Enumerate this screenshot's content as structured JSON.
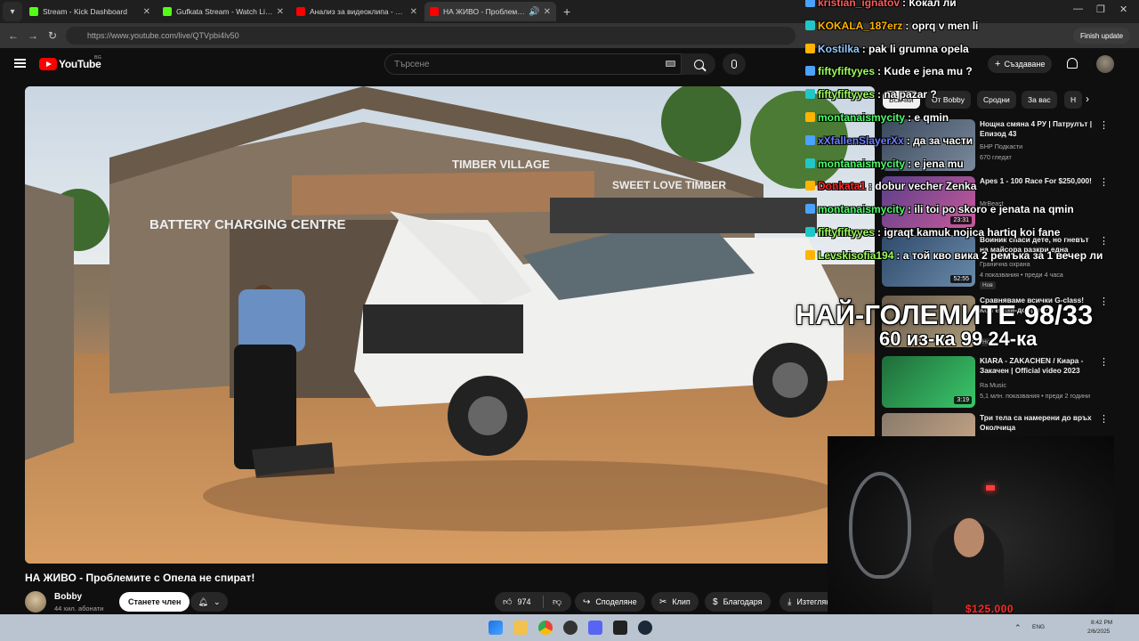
{
  "browser": {
    "tabs": [
      {
        "title": "Stream - Kick Dashboard",
        "color": "#53fc18",
        "active": false
      },
      {
        "title": "Gufkata Stream - Watch Live on Kick",
        "color": "#53fc18",
        "active": false
      },
      {
        "title": "Анализ за видеоклипа - YouTube Studio",
        "color": "#ff0000",
        "active": false
      },
      {
        "title": "НА ЖИВО - Проблемите с Опела не спират!",
        "color": "#ff0000",
        "active": true
      }
    ],
    "url": "https://www.youtube.com/live/QTVpbi4lv50",
    "finish_update": "Finish update"
  },
  "youtube": {
    "logo_text": "YouTube",
    "region": "BG",
    "search_placeholder": "Търсене",
    "create_label": "Създаване"
  },
  "video": {
    "title": "НА ЖИВО - Проблемите с Опела не спират!",
    "channel": "Bobby",
    "subscribers": "44 хил. абонати",
    "join_label": "Станете член",
    "likes": "974",
    "share_label": "Споделяне",
    "clip_label": "Клип",
    "thanks_label": "Благодаря",
    "download_label": "Изтегляне",
    "scene_signs": [
      "BATTERY CHARGING CENTRE",
      "TIMBER VILLAGE",
      "SWEET LOVE TIMBER"
    ]
  },
  "sidebar": {
    "chips": [
      "Всички",
      "От Bobby",
      "Сродни",
      "За вас",
      "Н"
    ],
    "recs": [
      {
        "title": "Нощна смяна 4 РУ | Патрулът | Епизод 43",
        "channel": "БНР Подкасти",
        "meta": "670 гледат",
        "badge": "",
        "duration": "",
        "thumb": "#3a4a5c"
      },
      {
        "title": "Apes 1 - 100 Race For $250,000!",
        "channel": "MrBeast",
        "meta": "",
        "badge": "",
        "duration": "23:31",
        "thumb": "#5a3e8a"
      },
      {
        "title": "Воиник спаси дете, но гневът на майсора разкри една",
        "channel": "Гранична охрана",
        "meta": "4 показвания • преди 4 часа",
        "badge": "Нов",
        "duration": "52:55",
        "thumb": "#2f4a6a"
      },
      {
        "title": "Сравняваме всички G-class! Кой е най-добрия?",
        "channel": "",
        "meta": "",
        "badge": "Нов",
        "duration": "",
        "thumb": "#6a5a4a"
      },
      {
        "title": "KIARA - ZAKACHEN / Киара - Закачен | Official video 2023",
        "channel": "Ra Music",
        "meta": "5,1 млн. показвания • преди 2 години",
        "badge": "",
        "duration": "3:19",
        "thumb": "#1f6b3a"
      },
      {
        "title": "Три тела са намерени до връх Околчица",
        "channel": "",
        "meta": "",
        "badge": "",
        "duration": "",
        "thumb": "#8a7a6a"
      }
    ]
  },
  "chat": [
    {
      "user": "kristian_ignatov",
      "msg": ": Кокал ли",
      "color": "#ff5a5a"
    },
    {
      "user": "KOKALA_187erz",
      "msg": ": oprq v men li",
      "color": "#ffb400"
    },
    {
      "user": "Kostilka",
      "msg": ": pak li grumna opela",
      "color": "#8ec9ff"
    },
    {
      "user": "fiftyfiftyyes",
      "msg": ": Kude e jena mu ?",
      "color": "#9cff5a"
    },
    {
      "user": "fiftyfiftyyes",
      "msg": ": na pazar ?",
      "color": "#9cff5a"
    },
    {
      "user": "montanaismycity",
      "msg": ": e qmin",
      "color": "#4cff6a"
    },
    {
      "user": "xXfallenSlayerXx",
      "msg": ": да за части",
      "color": "#6a7dff"
    },
    {
      "user": "montanaismycity",
      "msg": ": e jena mu",
      "color": "#4cff6a"
    },
    {
      "user": "Donkata1",
      "msg": ": dobur vecher Zenka",
      "color": "#ff2a2a"
    },
    {
      "user": "montanaismycity",
      "msg": ": ili toi po skoro e jenata na qmin",
      "color": "#4cff6a"
    },
    {
      "user": "fiftyfiftyyes",
      "msg": ": igraqt kamuk nojica hartiq koi fane",
      "color": "#9cff5a"
    },
    {
      "user": "Levskisofia194",
      "msg": ": а той кво вика 2 ремъка за 1 вечер ли",
      "color": "#9cff5a"
    }
  ],
  "overlay": {
    "line1": "НАЙ-ГОЛЕМИТЕ 98/33",
    "line2": "60 из-ка 99 24-ка"
  },
  "webcam": {
    "donation": "$125.000"
  },
  "taskbar": {
    "lang": "ENG",
    "time": "8:42 PM",
    "date": "2/6/2025"
  }
}
